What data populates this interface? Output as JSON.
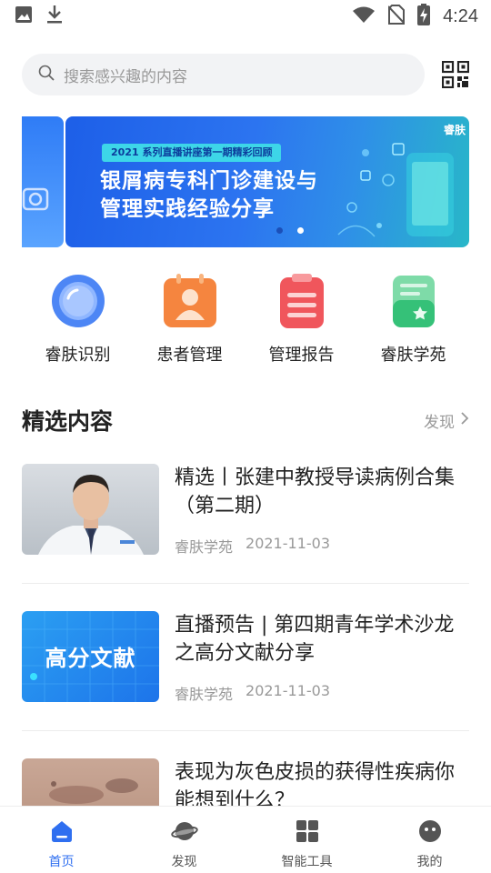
{
  "status_bar": {
    "time": "4:24",
    "icons": [
      "image-icon",
      "download-icon",
      "wifi-icon",
      "no-sim-icon",
      "battery-charging-icon"
    ]
  },
  "search": {
    "placeholder": "搜索感兴趣的内容",
    "qr_icon": "qr-code-icon"
  },
  "banner": {
    "tag": "2021 系列直播讲座第一期精彩回顾",
    "title_line1": "银屑病专科门诊建设与",
    "title_line2": "管理实践经验分享",
    "logo": "睿肤",
    "page_count": 2,
    "active_index": 1
  },
  "quick_links": [
    {
      "label": "睿肤识别",
      "icon": "lens-icon",
      "color": "#4d86f5"
    },
    {
      "label": "患者管理",
      "icon": "patient-icon",
      "color": "#f5853f"
    },
    {
      "label": "管理报告",
      "icon": "clipboard-icon",
      "color": "#f0565c"
    },
    {
      "label": "睿肤学苑",
      "icon": "book-icon",
      "color": "#35c178"
    }
  ],
  "section": {
    "title": "精选内容",
    "more": "发现"
  },
  "articles": [
    {
      "title": "精选丨张建中教授导读病例合集（第二期）",
      "source": "睿肤学苑",
      "date": "2021-11-03",
      "thumb": "doctor-photo"
    },
    {
      "title": "直播预告 | 第四期青年学术沙龙之高分文献分享",
      "source": "睿肤学苑",
      "date": "2021-11-03",
      "thumb": "高分文献"
    },
    {
      "title": "表现为灰色皮损的获得性疾病你能想到什么？",
      "source": "",
      "date": "",
      "thumb": "skin-photo"
    }
  ],
  "tabs": [
    {
      "label": "首页",
      "icon": "home-icon",
      "active": true
    },
    {
      "label": "发现",
      "icon": "planet-icon",
      "active": false
    },
    {
      "label": "智能工具",
      "icon": "grid-icon",
      "active": false
    },
    {
      "label": "我的",
      "icon": "user-icon",
      "active": false
    }
  ],
  "colors": {
    "accent": "#2f6ff0",
    "muted": "#999999"
  }
}
